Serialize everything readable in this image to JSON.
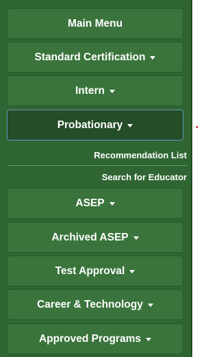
{
  "menu": {
    "main_menu": "Main Menu",
    "standard_certification": "Standard Certification",
    "intern": "Intern",
    "probationary": "Probationary",
    "probationary_submenu": {
      "recommendation_list": "Recommendation List",
      "search_for_educator": "Search for Educator"
    },
    "asep": "ASEP",
    "archived_asep": "Archived ASEP",
    "test_approval": "Test Approval",
    "career_technology": "Career & Technology",
    "approved_programs": "Approved Programs"
  },
  "icons": {
    "dropdown": "caret-down-icon"
  },
  "colors": {
    "sidebar_bg": "#2f6533",
    "button_bg": "#3a743c",
    "active_button_bg": "#254d28",
    "active_border": "#6a9ec6",
    "text": "#ffffff"
  }
}
